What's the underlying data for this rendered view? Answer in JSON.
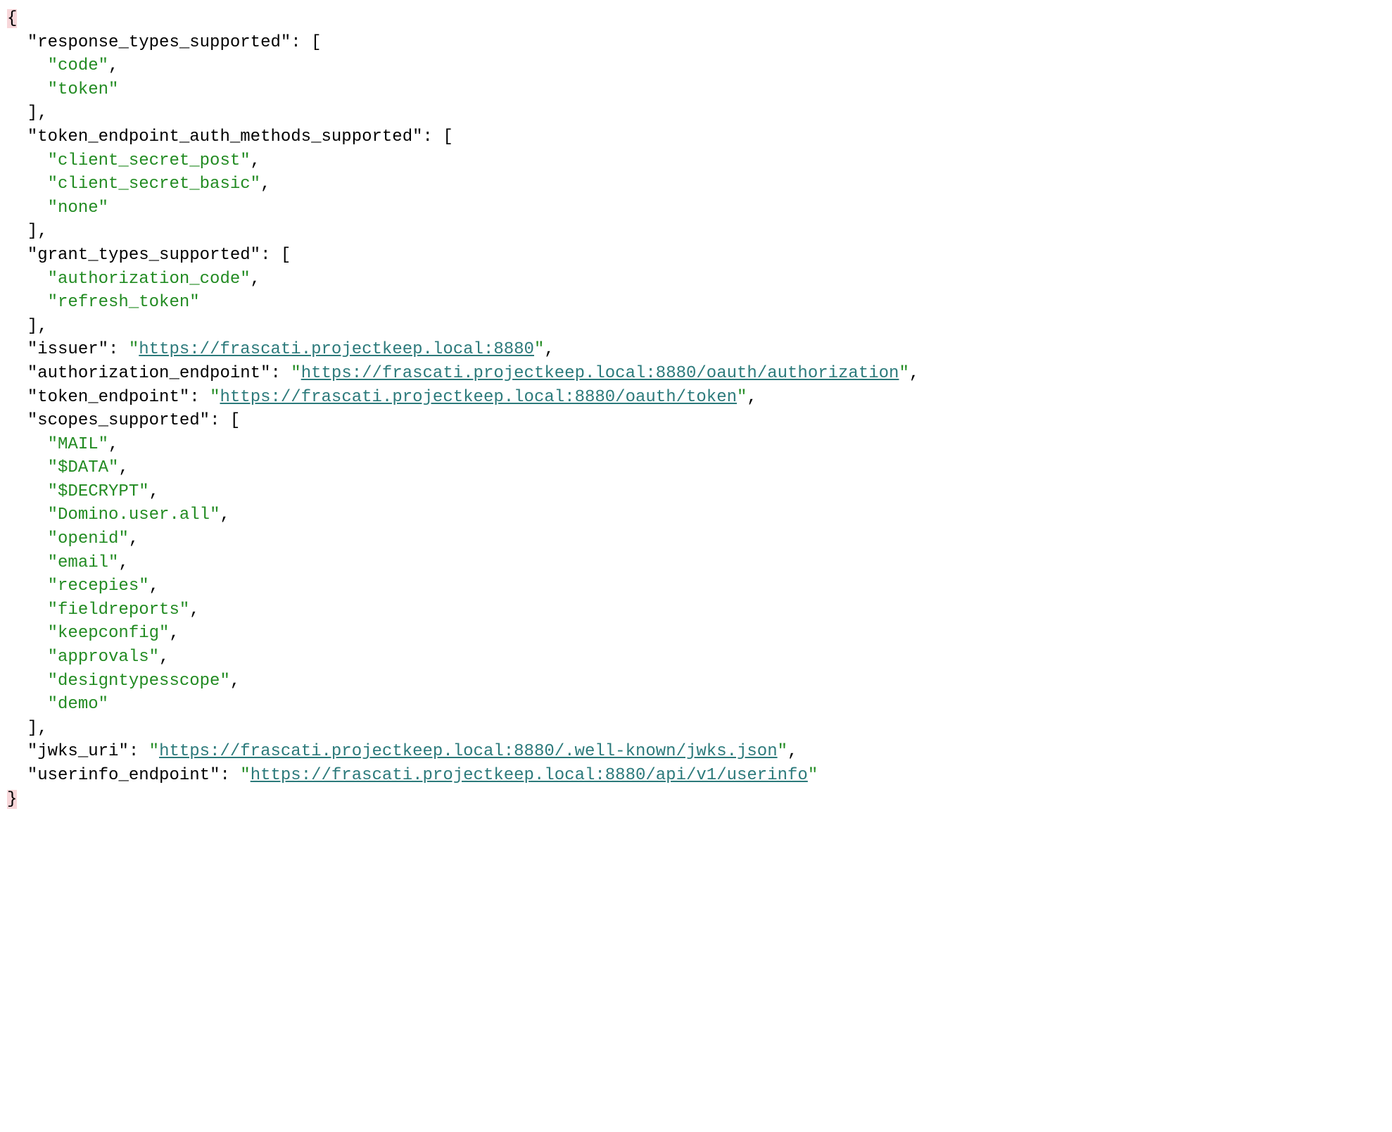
{
  "json": {
    "keys": {
      "response_types_supported": "response_types_supported",
      "token_endpoint_auth_methods_supported": "token_endpoint_auth_methods_supported",
      "grant_types_supported": "grant_types_supported",
      "issuer": "issuer",
      "authorization_endpoint": "authorization_endpoint",
      "token_endpoint": "token_endpoint",
      "scopes_supported": "scopes_supported",
      "jwks_uri": "jwks_uri",
      "userinfo_endpoint": "userinfo_endpoint"
    },
    "response_types": [
      "code",
      "token"
    ],
    "auth_methods": [
      "client_secret_post",
      "client_secret_basic",
      "none"
    ],
    "grant_types": [
      "authorization_code",
      "refresh_token"
    ],
    "issuer": "https://frascati.projectkeep.local:8880",
    "authorization_endpoint": "https://frascati.projectkeep.local:8880/oauth/authorization",
    "token_endpoint": "https://frascati.projectkeep.local:8880/oauth/token",
    "scopes": [
      "MAIL",
      "$DATA",
      "$DECRYPT",
      "Domino.user.all",
      "openid",
      "email",
      "recepies",
      "fieldreports",
      "keepconfig",
      "approvals",
      "designtypesscope",
      "demo"
    ],
    "jwks_uri": "https://frascati.projectkeep.local:8880/.well-known/jwks.json",
    "userinfo_endpoint": "https://frascati.projectkeep.local:8880/api/v1/userinfo"
  }
}
